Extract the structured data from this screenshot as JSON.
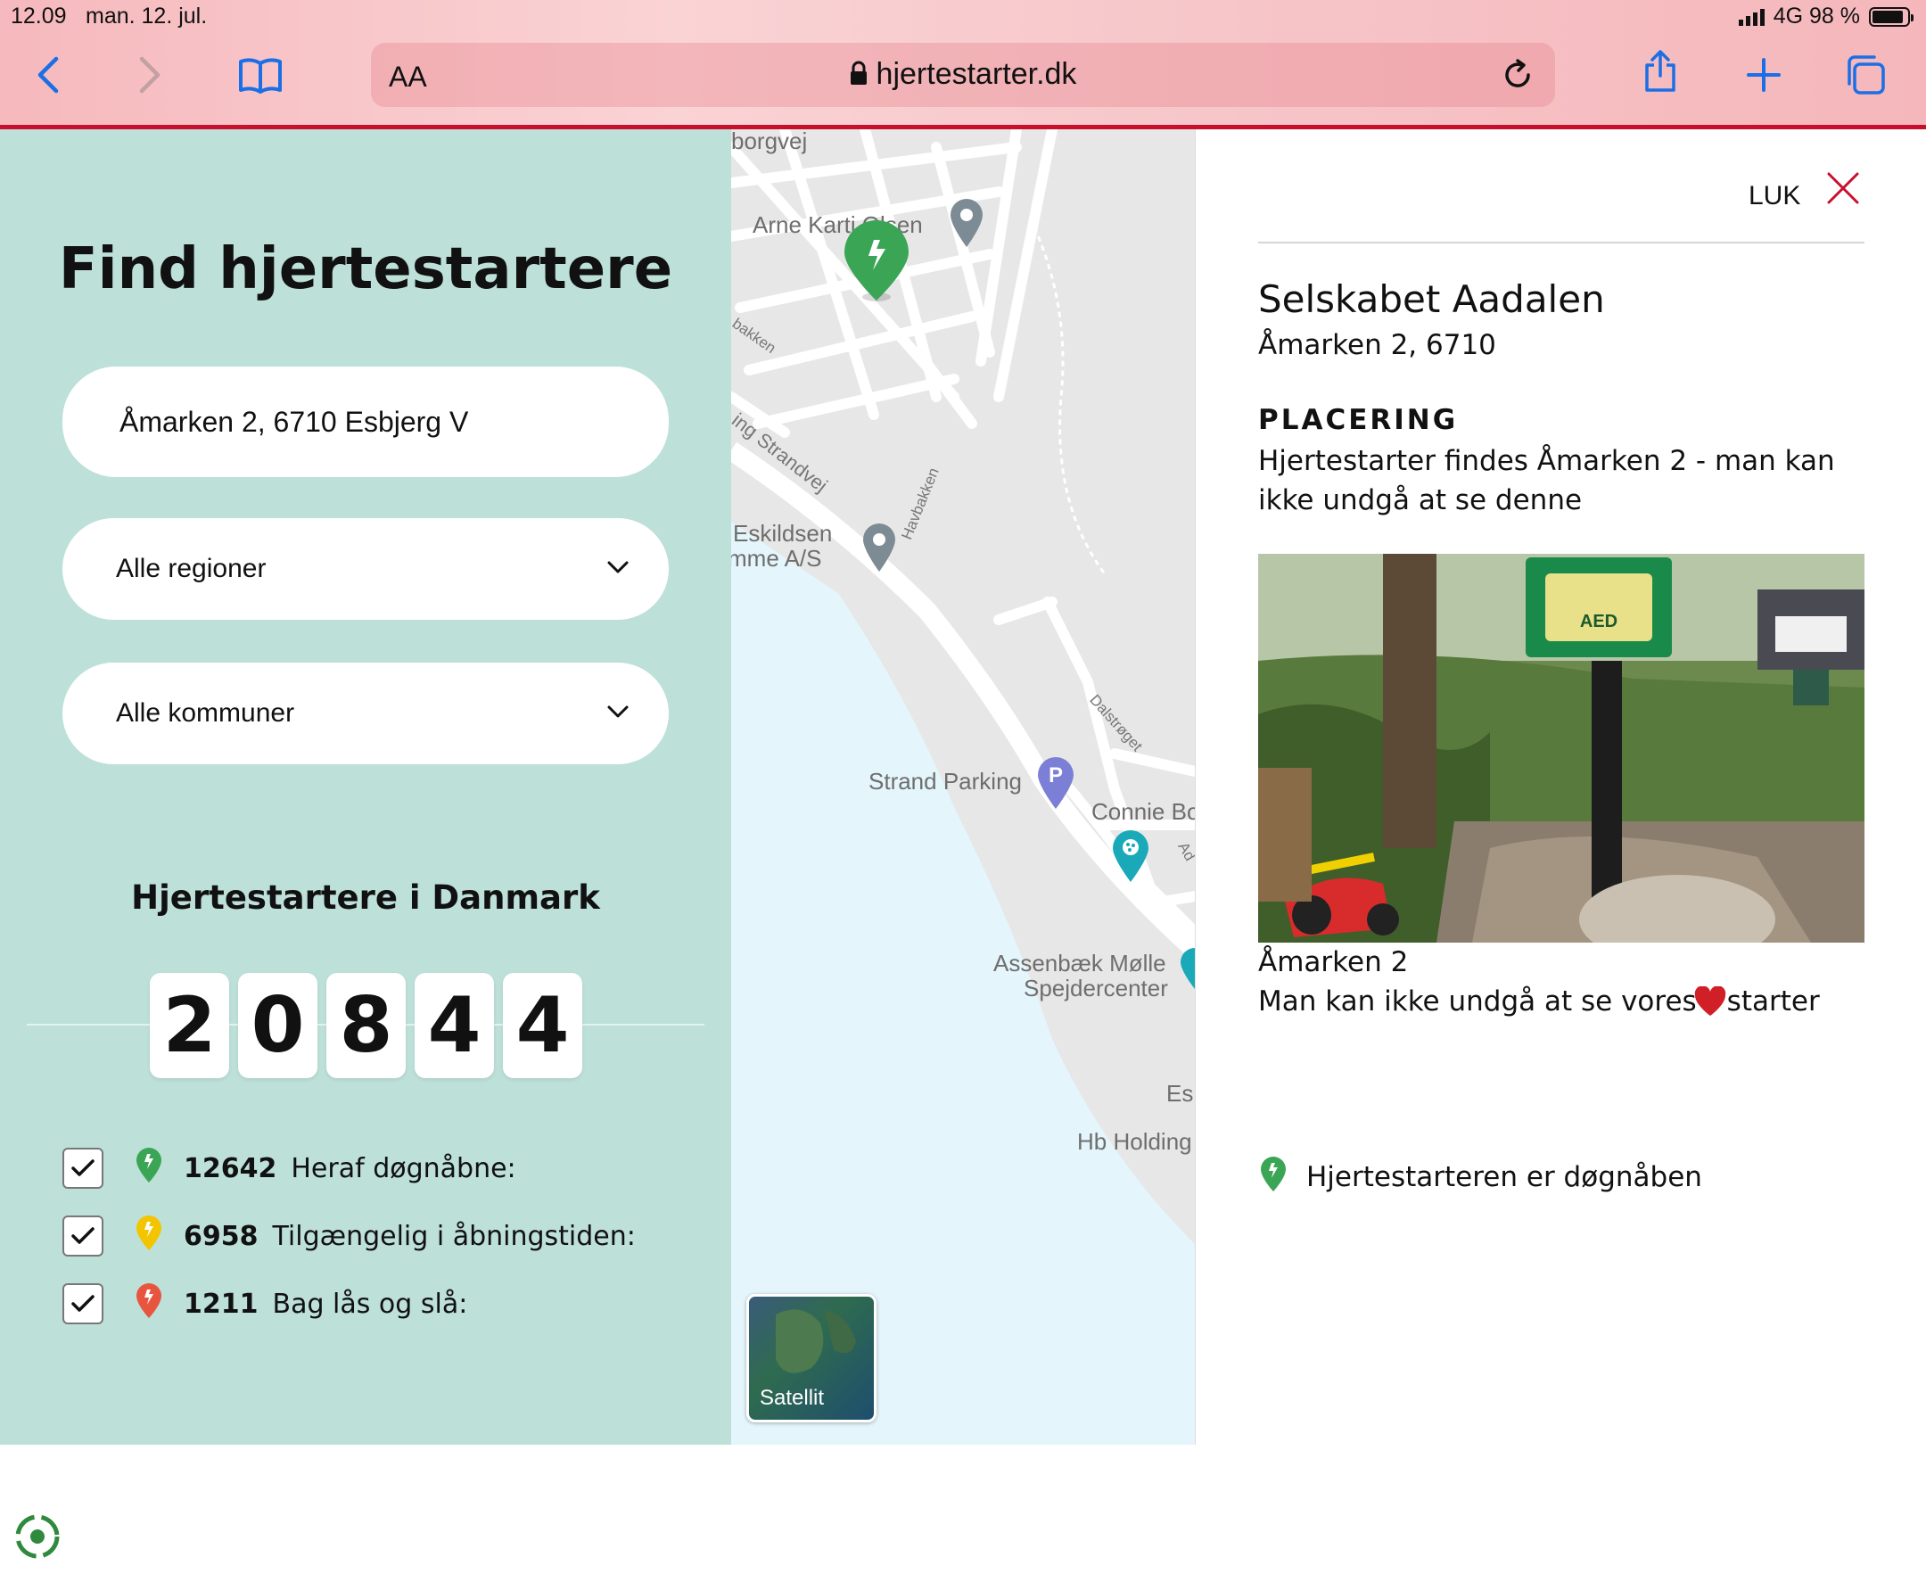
{
  "status": {
    "time": "12.09",
    "date": "man. 12. jul.",
    "network": "4G 98 %"
  },
  "browser": {
    "aa_label": "AA",
    "url": "hjertestarter.dk"
  },
  "left": {
    "title": "Find hjertestartere",
    "address_value": "Åmarken 2, 6710 Esbjerg V",
    "region_select": "Alle regioner",
    "kommune_select": "Alle kommuner",
    "subtitle": "Hjertestartere i Danmark",
    "counter_digits": [
      "2",
      "0",
      "8",
      "4",
      "4"
    ],
    "legend": [
      {
        "count": "12642",
        "label": "Heraf døgnåbne:",
        "color": "#3aa655",
        "checked": true
      },
      {
        "count": "6958",
        "label": "Tilgængelig i åbningstiden:",
        "color": "#f2c500",
        "checked": true
      },
      {
        "count": "1211",
        "label": "Bag lås og slå:",
        "color": "#e8553f",
        "checked": true
      }
    ]
  },
  "map": {
    "labels": {
      "borgvej": "borgvej",
      "arne": "Arne Karti    Olsen",
      "bakken": "bakken",
      "strandvej": "ing Strandvej",
      "havbakken": "Havbakken",
      "eskildsen1": "Eskildsen",
      "eskildsen2": "mme A/S",
      "dalstroget": "Dalstrøget",
      "strand_parking": "Strand Parking",
      "connie": "Connie Bo",
      "ad": "Ad",
      "assenbaek1": "Assenbæk Mølle",
      "assenbaek2": "Spejdercenter",
      "es": "Es",
      "hb": "Hb Holding"
    },
    "satellite_label": "Satellit"
  },
  "panel": {
    "close_label": "LUK",
    "name": "Selskabet Aadalen",
    "address": "Åmarken 2, 6710",
    "placement_heading": "PLACERING",
    "placement_text": "Hjertestarter findes Åmarken 2 - man kan ikke undgå at se denne",
    "aed_text": "AED",
    "caption_1": "Åmarken 2",
    "caption_2a": "Man kan ikke undgå at se vores ",
    "caption_2b": "starter",
    "open_status": "Hjertestarteren er døgnåben"
  },
  "colors": {
    "brand_red": "#c8102e",
    "mint": "#bde0d9",
    "green_pin": "#3aa655"
  }
}
